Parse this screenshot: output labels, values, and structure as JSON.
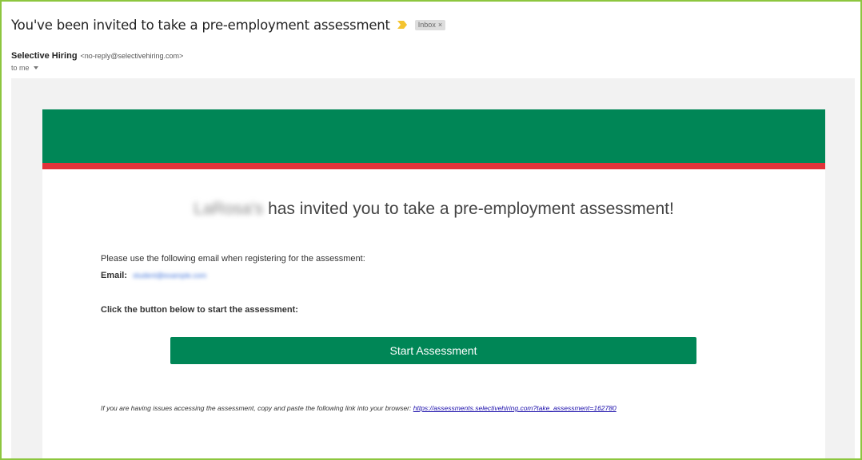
{
  "email": {
    "subject": "You've been invited to take a pre-employment assessment",
    "label_chip": "Inbox",
    "label_chip_close": "×",
    "sender_name": "Selective Hiring",
    "sender_address": "<no-reply@selectivehiring.com>",
    "recipient": "to me"
  },
  "message": {
    "company_name_blurred": "LaRosa's",
    "headline": "has invited you to take a pre-employment assessment!",
    "instruction": "Please use the following email when registering for the assessment:",
    "email_label": "Email:",
    "email_value_blurred": "student@example.com",
    "click_instruction": "Click the button below to start the assessment:",
    "button_label": "Start Assessment",
    "footer_text": "If you are having issues accessing the assessment, copy and paste the following link into your browser:",
    "footer_link": "https://assessments.selectivehiring.com?take_assessment=162780"
  },
  "colors": {
    "banner_green": "#008656",
    "banner_red_stripe": "#e1333a",
    "button_green": "#008656",
    "frame_border": "#8dc63f",
    "importance_marker": "#f4c430"
  },
  "icons": {
    "importance": "importance-marker-icon",
    "recipient_details": "chevron-down-icon",
    "remove_label": "close-icon"
  }
}
